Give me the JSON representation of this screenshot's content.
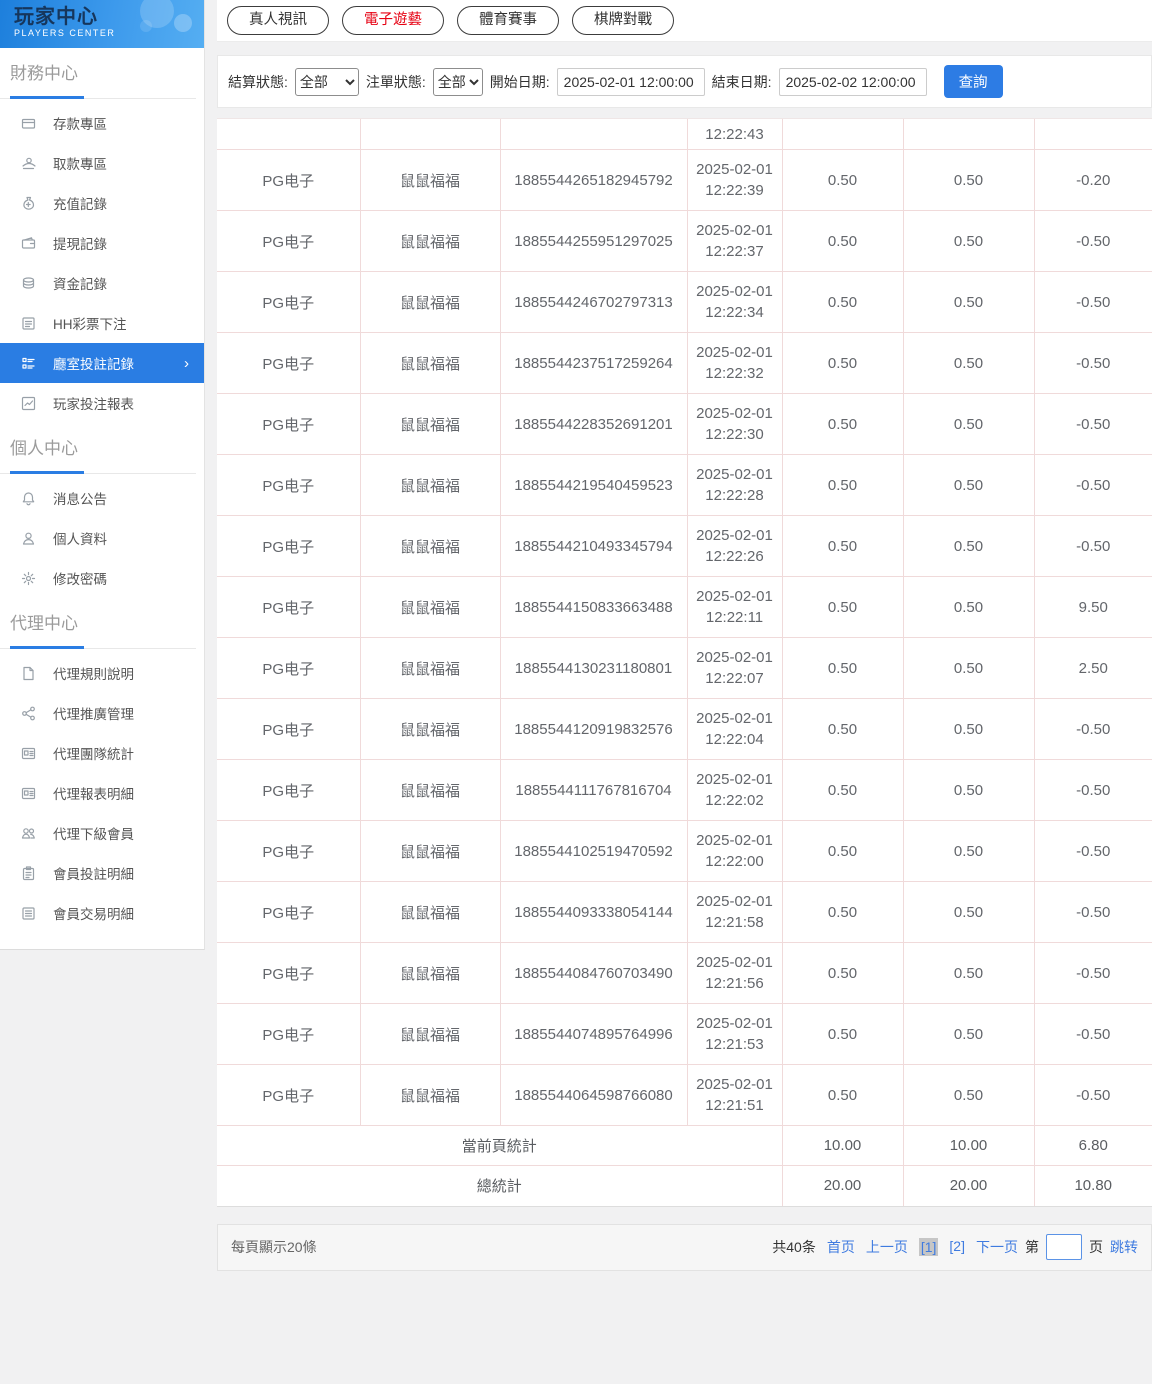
{
  "colors": {
    "accent_blue": "#2a7de3",
    "active_tab_red": "#e60012",
    "table_border_pink": "#f0dada"
  },
  "sidebar": {
    "title": "玩家中心",
    "subtitle": "PLAYERS CENTER",
    "active_chevron": "›",
    "sections": [
      {
        "label": "財務中心",
        "items": [
          {
            "icon": "deposit-icon",
            "label": "存款專區"
          },
          {
            "icon": "withdraw-icon",
            "label": "取款專區"
          },
          {
            "icon": "recharge-record-icon",
            "label": "充值記錄"
          },
          {
            "icon": "withdrawal-record-icon",
            "label": "提現記錄"
          },
          {
            "icon": "funds-record-icon",
            "label": "資金記錄"
          },
          {
            "icon": "lottery-bet-icon",
            "label": "HH彩票下注"
          },
          {
            "icon": "hall-bet-record-icon",
            "label": "廳室投註記錄",
            "active": true
          },
          {
            "icon": "player-report-icon",
            "label": "玩家投注報表"
          }
        ]
      },
      {
        "label": "個人中心",
        "items": [
          {
            "icon": "bell-icon",
            "label": "消息公告"
          },
          {
            "icon": "person-icon",
            "label": "個人資料"
          },
          {
            "icon": "gear-icon",
            "label": "修改密碼"
          }
        ]
      },
      {
        "label": "代理中心",
        "items": [
          {
            "icon": "document-icon",
            "label": "代理規則說明"
          },
          {
            "icon": "share-icon",
            "label": "代理推廣管理"
          },
          {
            "icon": "idcard-icon",
            "label": "代理團隊統計"
          },
          {
            "icon": "idcard-icon",
            "label": "代理報表明細"
          },
          {
            "icon": "users-icon",
            "label": "代理下級會員"
          },
          {
            "icon": "clipboard-icon",
            "label": "會員投註明細"
          },
          {
            "icon": "list-icon",
            "label": "會員交易明細"
          }
        ]
      }
    ]
  },
  "tabs": [
    {
      "label": "真人視訊"
    },
    {
      "label": "電子遊藝",
      "active": true
    },
    {
      "label": "體育賽事"
    },
    {
      "label": "棋牌對戰"
    }
  ],
  "filters": {
    "settle_status_label": "結算狀態:",
    "settle_status_value": "全部",
    "order_status_label": "注單狀態:",
    "order_status_value": "全部",
    "start_date_label": "開始日期:",
    "start_date_value": "2025-02-01 12:00:00",
    "end_date_label": "結束日期:",
    "end_date_value": "2025-02-02 12:00:00",
    "search_button": "查詢"
  },
  "table": {
    "partial_row_time": "12:22:43",
    "rows": [
      {
        "venue": "PG电子",
        "game": "鼠鼠福福",
        "order": "1885544265182945792",
        "date": "2025-02-01",
        "time": "12:22:39",
        "bet": "0.50",
        "valid_bet": "0.50",
        "profit": "-0.20"
      },
      {
        "venue": "PG电子",
        "game": "鼠鼠福福",
        "order": "1885544255951297025",
        "date": "2025-02-01",
        "time": "12:22:37",
        "bet": "0.50",
        "valid_bet": "0.50",
        "profit": "-0.50"
      },
      {
        "venue": "PG电子",
        "game": "鼠鼠福福",
        "order": "1885544246702797313",
        "date": "2025-02-01",
        "time": "12:22:34",
        "bet": "0.50",
        "valid_bet": "0.50",
        "profit": "-0.50"
      },
      {
        "venue": "PG电子",
        "game": "鼠鼠福福",
        "order": "1885544237517259264",
        "date": "2025-02-01",
        "time": "12:22:32",
        "bet": "0.50",
        "valid_bet": "0.50",
        "profit": "-0.50"
      },
      {
        "venue": "PG电子",
        "game": "鼠鼠福福",
        "order": "1885544228352691201",
        "date": "2025-02-01",
        "time": "12:22:30",
        "bet": "0.50",
        "valid_bet": "0.50",
        "profit": "-0.50"
      },
      {
        "venue": "PG电子",
        "game": "鼠鼠福福",
        "order": "1885544219540459523",
        "date": "2025-02-01",
        "time": "12:22:28",
        "bet": "0.50",
        "valid_bet": "0.50",
        "profit": "-0.50"
      },
      {
        "venue": "PG电子",
        "game": "鼠鼠福福",
        "order": "1885544210493345794",
        "date": "2025-02-01",
        "time": "12:22:26",
        "bet": "0.50",
        "valid_bet": "0.50",
        "profit": "-0.50"
      },
      {
        "venue": "PG电子",
        "game": "鼠鼠福福",
        "order": "1885544150833663488",
        "date": "2025-02-01",
        "time": "12:22:11",
        "bet": "0.50",
        "valid_bet": "0.50",
        "profit": "9.50"
      },
      {
        "venue": "PG电子",
        "game": "鼠鼠福福",
        "order": "1885544130231180801",
        "date": "2025-02-01",
        "time": "12:22:07",
        "bet": "0.50",
        "valid_bet": "0.50",
        "profit": "2.50"
      },
      {
        "venue": "PG电子",
        "game": "鼠鼠福福",
        "order": "1885544120919832576",
        "date": "2025-02-01",
        "time": "12:22:04",
        "bet": "0.50",
        "valid_bet": "0.50",
        "profit": "-0.50"
      },
      {
        "venue": "PG电子",
        "game": "鼠鼠福福",
        "order": "1885544111767816704",
        "date": "2025-02-01",
        "time": "12:22:02",
        "bet": "0.50",
        "valid_bet": "0.50",
        "profit": "-0.50"
      },
      {
        "venue": "PG电子",
        "game": "鼠鼠福福",
        "order": "1885544102519470592",
        "date": "2025-02-01",
        "time": "12:22:00",
        "bet": "0.50",
        "valid_bet": "0.50",
        "profit": "-0.50"
      },
      {
        "venue": "PG电子",
        "game": "鼠鼠福福",
        "order": "1885544093338054144",
        "date": "2025-02-01",
        "time": "12:21:58",
        "bet": "0.50",
        "valid_bet": "0.50",
        "profit": "-0.50"
      },
      {
        "venue": "PG电子",
        "game": "鼠鼠福福",
        "order": "1885544084760703490",
        "date": "2025-02-01",
        "time": "12:21:56",
        "bet": "0.50",
        "valid_bet": "0.50",
        "profit": "-0.50"
      },
      {
        "venue": "PG电子",
        "game": "鼠鼠福福",
        "order": "1885544074895764996",
        "date": "2025-02-01",
        "time": "12:21:53",
        "bet": "0.50",
        "valid_bet": "0.50",
        "profit": "-0.50"
      },
      {
        "venue": "PG电子",
        "game": "鼠鼠福福",
        "order": "1885544064598766080",
        "date": "2025-02-01",
        "time": "12:21:51",
        "bet": "0.50",
        "valid_bet": "0.50",
        "profit": "-0.50"
      }
    ],
    "summary": [
      {
        "label": "當前頁統計",
        "bet": "10.00",
        "valid_bet": "10.00",
        "profit": "6.80"
      },
      {
        "label": "總統計",
        "bet": "20.00",
        "valid_bet": "20.00",
        "profit": "10.80"
      }
    ]
  },
  "pagination": {
    "page_size_text": "每頁顯示20條",
    "total_text": "共40条",
    "first": "首页",
    "prev": "上一页",
    "pages": [
      "[1]",
      "[2]"
    ],
    "current_page_index": 0,
    "next": "下一页",
    "jump_prefix": "第",
    "jump_suffix": "页",
    "jump_action": "跳转",
    "jump_input_value": ""
  }
}
